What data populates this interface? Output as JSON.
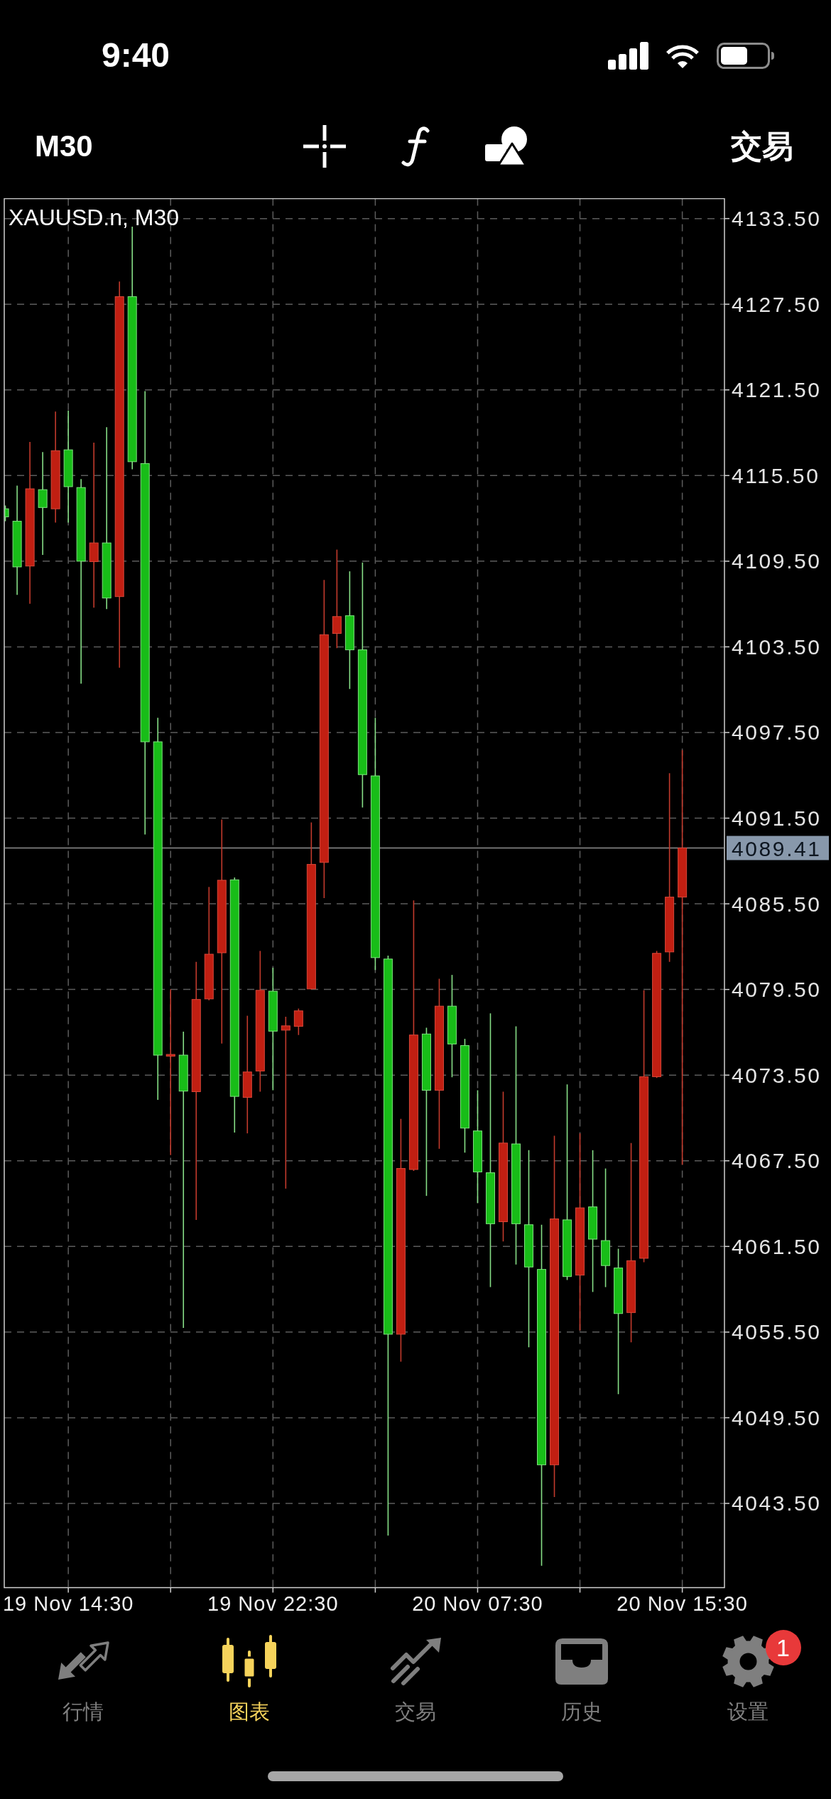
{
  "status_bar": {
    "time": "9:40"
  },
  "toolbar": {
    "timeframe": "M30",
    "trade_button": "交易"
  },
  "chart": {
    "chart_data": {
      "type": "candlestick",
      "title": "XAUUSD.n, M30",
      "grid": true,
      "ylim": [
        4037.6,
        4134.9
      ],
      "categories": [
        null,
        null,
        null,
        null,
        null,
        "19 Nov 14:30",
        null,
        null,
        null,
        null,
        null,
        null,
        null,
        null,
        null,
        null,
        null,
        null,
        null,
        null,
        null,
        "19 Nov 22:30",
        null,
        null,
        null,
        null,
        null,
        null,
        null,
        null,
        null,
        null,
        null,
        null,
        null,
        null,
        null,
        "20 Nov 07:30",
        null,
        null,
        null,
        null,
        null,
        null,
        null,
        null,
        null,
        null,
        null,
        null,
        null,
        null,
        null,
        "20 Nov 15:30"
      ],
      "yticks": [
        {
          "value": 4133.5,
          "label": "4133.50"
        },
        {
          "value": 4127.5,
          "label": "4127.50"
        },
        {
          "value": 4121.5,
          "label": "4121.50"
        },
        {
          "value": 4115.5,
          "label": "4115.50"
        },
        {
          "value": 4109.5,
          "label": "4109.50"
        },
        {
          "value": 4103.5,
          "label": "4103.50"
        },
        {
          "value": 4097.5,
          "label": "4097.50"
        },
        {
          "value": 4091.5,
          "label": "4091.50"
        },
        {
          "value": 4085.5,
          "label": "4085.50"
        },
        {
          "value": 4079.5,
          "label": "4079.50"
        },
        {
          "value": 4073.5,
          "label": "4073.50"
        },
        {
          "value": 4067.5,
          "label": "4067.50"
        },
        {
          "value": 4061.5,
          "label": "4061.50"
        },
        {
          "value": 4055.5,
          "label": "4055.50"
        },
        {
          "value": 4049.5,
          "label": "4049.50"
        },
        {
          "value": 4043.5,
          "label": "4043.50"
        }
      ],
      "ohlc": [
        [
          4113.17,
          4113.4,
          4112.3,
          4112.61
        ],
        [
          4112.3,
          4114.79,
          4107.14,
          4109.1
        ],
        [
          4109.16,
          4117.86,
          4106.52,
          4114.57
        ],
        [
          4114.51,
          4117.15,
          4109.94,
          4113.26
        ],
        [
          4113.17,
          4119.98,
          4112.21,
          4117.24
        ],
        [
          4117.3,
          4120.04,
          4112.21,
          4114.72
        ],
        [
          4114.66,
          4115.25,
          4100.92,
          4109.5
        ],
        [
          4109.47,
          4117.8,
          4106.24,
          4110.78
        ],
        [
          4110.78,
          4118.89,
          4106.14,
          4106.92
        ],
        [
          4107.02,
          4129.09,
          4102.04,
          4128.03
        ],
        [
          4128.03,
          4132.94,
          4115.94,
          4116.47
        ],
        [
          4116.34,
          4121.41,
          4090.35,
          4096.85
        ],
        [
          4096.85,
          4098.53,
          4071.77,
          4074.9
        ],
        [
          4074.85,
          4079.51,
          4067.9,
          4074.95
        ],
        [
          4074.9,
          4076.55,
          4055.79,
          4072.38
        ],
        [
          4072.34,
          4081.43,
          4063.36,
          4078.8
        ],
        [
          4078.84,
          4086.68,
          4078.74,
          4081.97
        ],
        [
          4082.07,
          4091.4,
          4075.71,
          4087.15
        ],
        [
          4087.18,
          4087.35,
          4069.48,
          4072.01
        ],
        [
          4071.94,
          4077.66,
          4069.42,
          4073.72
        ],
        [
          4073.79,
          4082.2,
          4072.34,
          4079.44
        ],
        [
          4079.38,
          4081.02,
          4072.44,
          4076.58
        ],
        [
          4076.65,
          4077.59,
          4065.55,
          4076.95
        ],
        [
          4076.92,
          4078.16,
          4076.31,
          4078.0
        ],
        [
          4079.54,
          4091.2,
          4079.5,
          4088.26
        ],
        [
          4088.4,
          4108.19,
          4085.9,
          4104.35
        ],
        [
          4104.44,
          4110.31,
          4103.41,
          4105.62
        ],
        [
          4105.68,
          4108.79,
          4100.55,
          4103.29
        ],
        [
          4103.29,
          4109.41,
          4092.25,
          4094.55
        ],
        [
          4094.46,
          4098.53,
          4080.86,
          4081.73
        ],
        [
          4081.63,
          4081.87,
          4041.25,
          4055.35
        ],
        [
          4055.35,
          4070.43,
          4053.43,
          4066.96
        ],
        [
          4066.89,
          4085.74,
          4066.79,
          4076.31
        ],
        [
          4076.38,
          4076.82,
          4065.04,
          4072.44
        ],
        [
          4072.44,
          4080.25,
          4068.34,
          4078.33
        ],
        [
          4078.33,
          4080.52,
          4073.35,
          4075.68
        ],
        [
          4075.57,
          4076.04,
          4068.07,
          4069.79
        ],
        [
          4069.59,
          4072.44,
          4064.54,
          4066.72
        ],
        [
          4066.66,
          4077.83,
          4058.65,
          4063.09
        ],
        [
          4063.23,
          4072.34,
          4061.85,
          4068.74
        ],
        [
          4068.68,
          4076.92,
          4060.23,
          4063.09
        ],
        [
          4063.02,
          4068.24,
          4054.44,
          4060.06
        ],
        [
          4059.89,
          4063.02,
          4039.13,
          4046.2
        ],
        [
          4046.2,
          4069.25,
          4043.95,
          4063.43
        ],
        [
          4063.36,
          4072.85,
          4059.15,
          4059.39
        ],
        [
          4059.49,
          4069.42,
          4055.62,
          4064.2
        ],
        [
          4064.27,
          4068.24,
          4058.31,
          4062.01
        ],
        [
          4061.91,
          4066.96,
          4058.65,
          4060.16
        ],
        [
          4059.99,
          4061.34,
          4051.15,
          4056.8
        ],
        [
          4056.87,
          4068.74,
          4054.78,
          4060.5
        ],
        [
          4060.67,
          4079.44,
          4060.4,
          4073.39
        ],
        [
          4073.39,
          4082.2,
          4073.3,
          4082.03
        ],
        [
          4082.13,
          4094.65,
          4081.43,
          4085.97
        ],
        [
          4085.97,
          4096.27,
          4067.23,
          4089.41
        ]
      ],
      "ref_lines": [
        {
          "axis": "y",
          "value": 4089.41,
          "label": "4089.41"
        }
      ]
    }
  },
  "tab_bar": {
    "tabs": [
      {
        "label": "行情",
        "selected": false
      },
      {
        "label": "图表",
        "selected": true
      },
      {
        "label": "交易",
        "selected": false
      },
      {
        "label": "历史",
        "selected": false
      },
      {
        "label": "设置",
        "selected": false,
        "badge": "1"
      }
    ]
  }
}
